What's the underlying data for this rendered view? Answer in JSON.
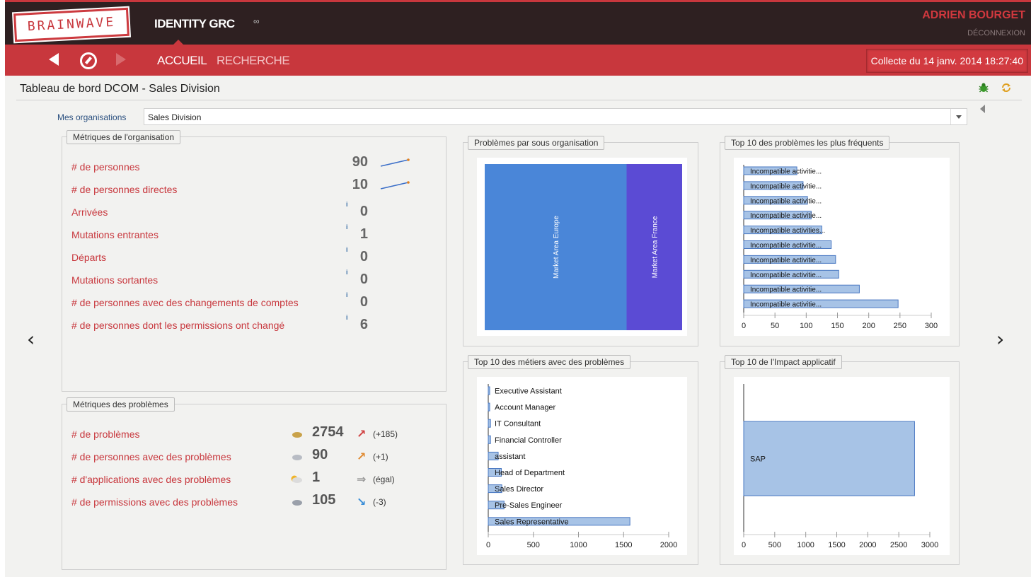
{
  "header": {
    "logo_text": "BRAINWAVE",
    "app_title": "IDENTITY GRC",
    "app_symbol": "∞",
    "user_name": "ADRIEN BOURGET",
    "logout_label": "DÉCONNEXION"
  },
  "nav": {
    "home_label": "ACCUEIL",
    "search_label": "RECHERCHE",
    "collect_label": "Collecte du 14 janv. 2014 18:27:40"
  },
  "page": {
    "title": "Tableau de bord DCOM - Sales Division",
    "org_label": "Mes organisations",
    "org_value": "Sales Division"
  },
  "org_metrics": {
    "legend": "Métriques de l'organisation",
    "items": [
      {
        "label": "# de personnes",
        "value": "90",
        "sparkline": true
      },
      {
        "label": "# de personnes directes",
        "value": "10",
        "sparkline": true
      },
      {
        "label": "Arrivées",
        "value": "0",
        "info": "i"
      },
      {
        "label": "Mutations entrantes",
        "value": "1",
        "info": "i"
      },
      {
        "label": "Départs",
        "value": "0",
        "info": "i"
      },
      {
        "label": "Mutations sortantes",
        "value": "0",
        "info": "i"
      },
      {
        "label": "# de personnes avec des changements de comptes",
        "value": "0",
        "info": "i"
      },
      {
        "label": "# de personnes dont les permissions ont changé",
        "value": "6",
        "info": "i"
      }
    ]
  },
  "issue_metrics": {
    "legend": "Métriques des problèmes",
    "items": [
      {
        "label": "# de problèmes",
        "value": "2754",
        "delta": "(+185)",
        "weather": "storm",
        "trend": "up-red"
      },
      {
        "label": "# de personnes avec des problèmes",
        "value": "90",
        "delta": "(+1)",
        "weather": "cloudy",
        "trend": "up-orange"
      },
      {
        "label": "# d'applications avec des problèmes",
        "value": "1",
        "delta": "(égal)",
        "weather": "partly-sunny",
        "trend": "flat"
      },
      {
        "label": "# de permissions avec des problèmes",
        "value": "105",
        "delta": "(-3)",
        "weather": "rain",
        "trend": "down-blue"
      }
    ]
  },
  "colors": {
    "brand_red": "#c8373d",
    "header_dark": "#2e2021",
    "bar_blue": "#a7c3e6",
    "bar_border": "#4a78c2",
    "area_blue": "#4a86d8",
    "area_purple": "#5b4bd4"
  },
  "chart_data": [
    {
      "id": "sub-org",
      "type": "area",
      "title": "Problèmes par sous organisation",
      "categories": [
        "Market Area Europe",
        "Market Area France"
      ],
      "values": [
        1979,
        775
      ]
    },
    {
      "id": "top-problems",
      "type": "bar",
      "title": "Top 10 des problèmes les plus fréquents",
      "orientation": "horizontal",
      "categories": [
        "Incompatible activitie...",
        "Incompatible activitie...",
        "Incompatible activitie...",
        "Incompatible activitie...",
        "Incompatible activities...",
        "Incompatible activitie...",
        "Incompatible activitie...",
        "Incompatible activitie...",
        "Incompatible activitie...",
        "Incompatible activitie..."
      ],
      "values": [
        85,
        95,
        102,
        108,
        125,
        140,
        147,
        152,
        185,
        247
      ],
      "xlim": [
        0,
        300
      ],
      "xticks": [
        0,
        50,
        100,
        150,
        200,
        250,
        300
      ]
    },
    {
      "id": "top-jobs",
      "type": "bar",
      "title": "Top 10 des métiers avec des problèmes",
      "orientation": "horizontal",
      "categories": [
        "Executive Assistant",
        "Account Manager",
        "IT Consultant",
        "Financial Controller",
        "assistant",
        "Head of Department",
        "Sales Director",
        "Pre-Sales Engineer",
        "Sales Representative"
      ],
      "values": [
        3,
        8,
        25,
        25,
        110,
        145,
        150,
        175,
        1570
      ],
      "xlim": [
        0,
        2000
      ],
      "xticks": [
        0,
        500,
        1000,
        1500,
        2000
      ]
    },
    {
      "id": "app-impact",
      "type": "bar",
      "title": "Top 10 de l'Impact applicatif",
      "orientation": "horizontal",
      "categories": [
        "SAP"
      ],
      "values": [
        2754
      ],
      "xlim": [
        0,
        3000
      ],
      "xticks": [
        0,
        500,
        1000,
        1500,
        2000,
        2500,
        3000
      ]
    }
  ]
}
